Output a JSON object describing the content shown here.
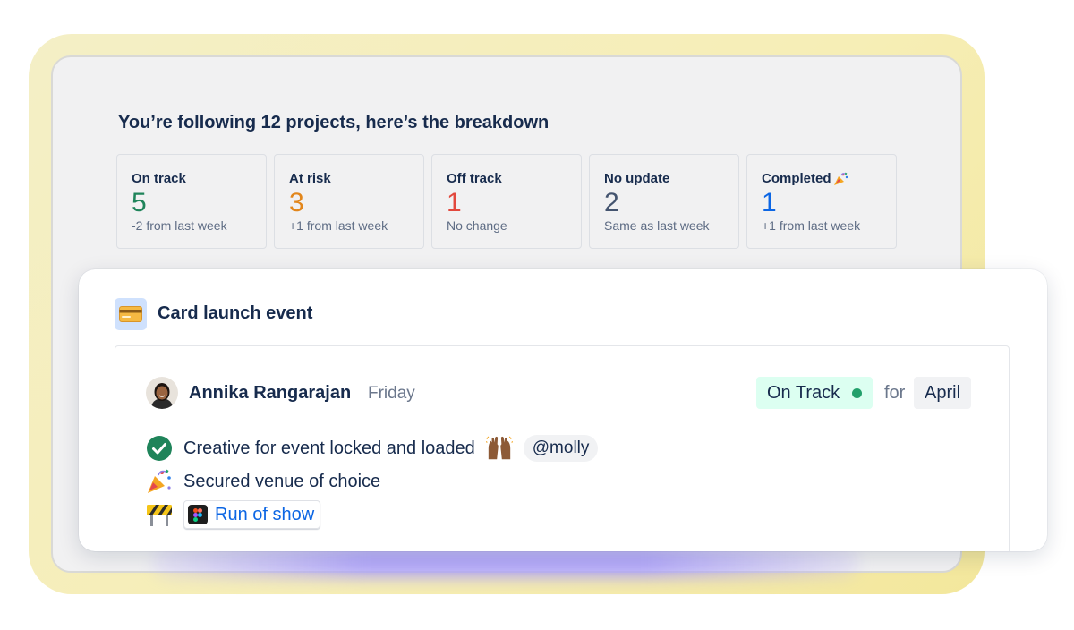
{
  "breakdown": {
    "headline": "You’re following 12 projects, here’s the breakdown",
    "stats": [
      {
        "label": "On track",
        "value": "5",
        "note": "-2 from last week",
        "color": "#1f845a"
      },
      {
        "label": "At risk",
        "value": "3",
        "note": "+1 from last week",
        "color": "#e2861b"
      },
      {
        "label": "Off track",
        "value": "1",
        "note": "No change",
        "color": "#e2483d"
      },
      {
        "label": "No update",
        "value": "2",
        "note": "Same as last week",
        "color": "#44546f"
      },
      {
        "label": "Completed",
        "value": "1",
        "note": "+1 from last week",
        "color": "#0c66e4",
        "icon": "party-popper-icon"
      }
    ]
  },
  "project": {
    "icon": "credit-card-icon",
    "title": "Card launch event",
    "update": {
      "author": "Annika Rangarajan",
      "when": "Friday",
      "status": "On Track",
      "status_color": "#22a06b",
      "for_word": "for",
      "period": "April",
      "items": [
        {
          "icon": "check-circle-icon",
          "text": "Creative for event locked and loaded",
          "reaction_icon": "raising-hands-icon",
          "mention": "@molly"
        },
        {
          "icon": "party-popper-icon",
          "text": "Secured venue of choice"
        },
        {
          "icon": "construction-icon",
          "link_icon": "figma-icon",
          "link_text": "Run of show"
        }
      ]
    }
  }
}
